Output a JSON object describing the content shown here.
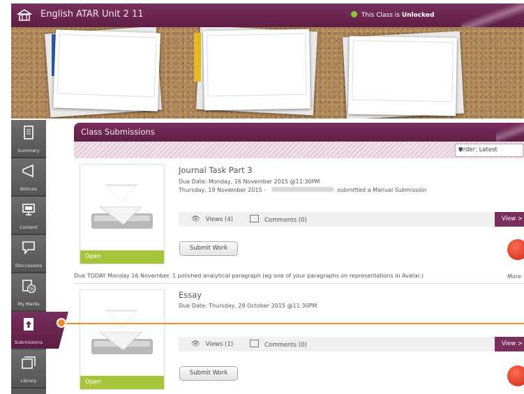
{
  "header": {
    "course_title": "English ATAR Unit 2 11",
    "status_prefix": "This Class is ",
    "status_value": "Unlocked",
    "status_color": "#8ac53f",
    "brand_color": "#6b2650"
  },
  "sidebar": {
    "items": [
      {
        "label": "Summary",
        "icon": "document-icon"
      },
      {
        "label": "Notices",
        "icon": "megaphone-icon"
      },
      {
        "label": "Content",
        "icon": "monitor-icon"
      },
      {
        "label": "Discussions",
        "icon": "speech-bubble-icon"
      },
      {
        "label": "My Marks",
        "icon": "percent-document-icon"
      },
      {
        "label": "Submissions",
        "icon": "upload-icon",
        "active": true
      },
      {
        "label": "Library",
        "icon": "folders-icon"
      }
    ]
  },
  "panel": {
    "title": "Class Submissions",
    "order_label": "Order: Latest"
  },
  "submissions": [
    {
      "title": "Journal Task Part 3",
      "due": "Due Date:  Monday, 16 November 2015 @11:30PM",
      "activity_date": "Thursday, 19 November 2015 - ",
      "activity_text": "submitted a Manual Submission",
      "views": "Views (4)",
      "comments": "Comments (0)",
      "view_button": "View >",
      "submit_button": "Submit Work",
      "status": "Open",
      "description": "Due TODAY Monday 16 November. 1 polished analytical paragraph (eg one of your paragraphs on representations in Avatar.)",
      "more": "More"
    },
    {
      "title": "Essay",
      "due": "Due Date: Thursday, 29 October 2015 @11:30PM",
      "views": "Views (1)",
      "comments": "Comments (0)",
      "view_button": "View >",
      "submit_button": "Submit Work",
      "status": "Open"
    }
  ]
}
